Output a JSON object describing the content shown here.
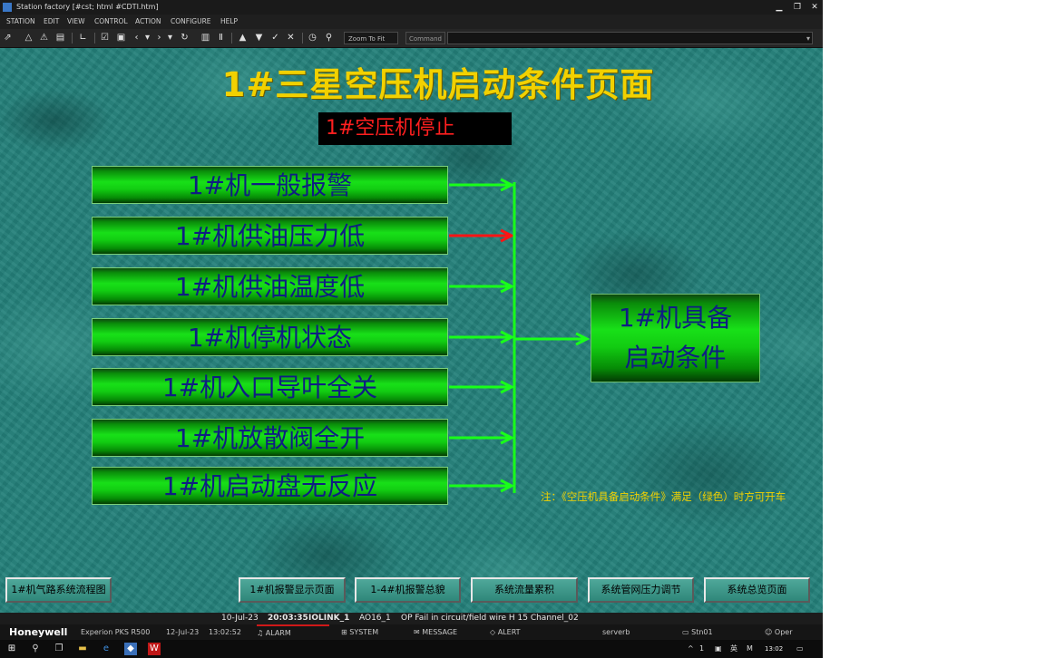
{
  "window": {
    "title": "Station   factory   [#cst; html #CDTI.htm]",
    "controls": [
      "▁",
      "❐",
      "✕"
    ]
  },
  "menu": [
    "STATION",
    "EDIT",
    "VIEW",
    "CONTROL",
    "ACTION",
    "CONFIGURE",
    "HELP"
  ],
  "toolbar": {
    "zoom_value": "Zoom To Fit",
    "command_label": "Command",
    "command_value": ""
  },
  "display": {
    "title": "1#三星空压机启动条件页面",
    "status_banner": "1#空压机停止",
    "conditions": [
      {
        "label": "1#机一般报警",
        "state": "ok"
      },
      {
        "label": "1#机供油压力低",
        "state": "fault"
      },
      {
        "label": "1#机供油温度低",
        "state": "ok"
      },
      {
        "label": "1#机停机状态",
        "state": "ok"
      },
      {
        "label": "1#机入口导叶全关",
        "state": "ok"
      },
      {
        "label": "1#机放散阀全开",
        "state": "ok"
      },
      {
        "label": "1#机启动盘无反应",
        "state": "ok"
      }
    ],
    "result": {
      "line1": "1#机具备",
      "line2": "启动条件"
    },
    "note": "注：《空压机具备启动条件》满足（绿色）时方可开车",
    "colors": {
      "ok": "#19ff19",
      "fault": "#ff1414",
      "title": "#f2d100"
    },
    "nav_buttons": [
      "1#机气路系统流程图",
      "1#机报警显示页面",
      "1-4#机报警总貌",
      "系统流量累积",
      "系统管网压力调节",
      "系统总览页面"
    ]
  },
  "alarm_line": {
    "date": "10-Jul-23",
    "time": "20:03:35",
    "tag": "IOLINK_1",
    "point": "AO16_1",
    "message": "OP Fail in circuit/field wire  H 15 Channel_02"
  },
  "status_bar": {
    "brand": "Honeywell",
    "product": "Experion PKS R500",
    "date": "12-Jul-23",
    "time": "13:02:52",
    "tabs": [
      "ALARM",
      "SYSTEM",
      "MESSAGE",
      "ALERT"
    ],
    "server": "serverb",
    "station": "Stn01",
    "user": "Oper"
  },
  "taskbar": {
    "tray_text": "1",
    "ime": "英",
    "clock": "13:02"
  }
}
